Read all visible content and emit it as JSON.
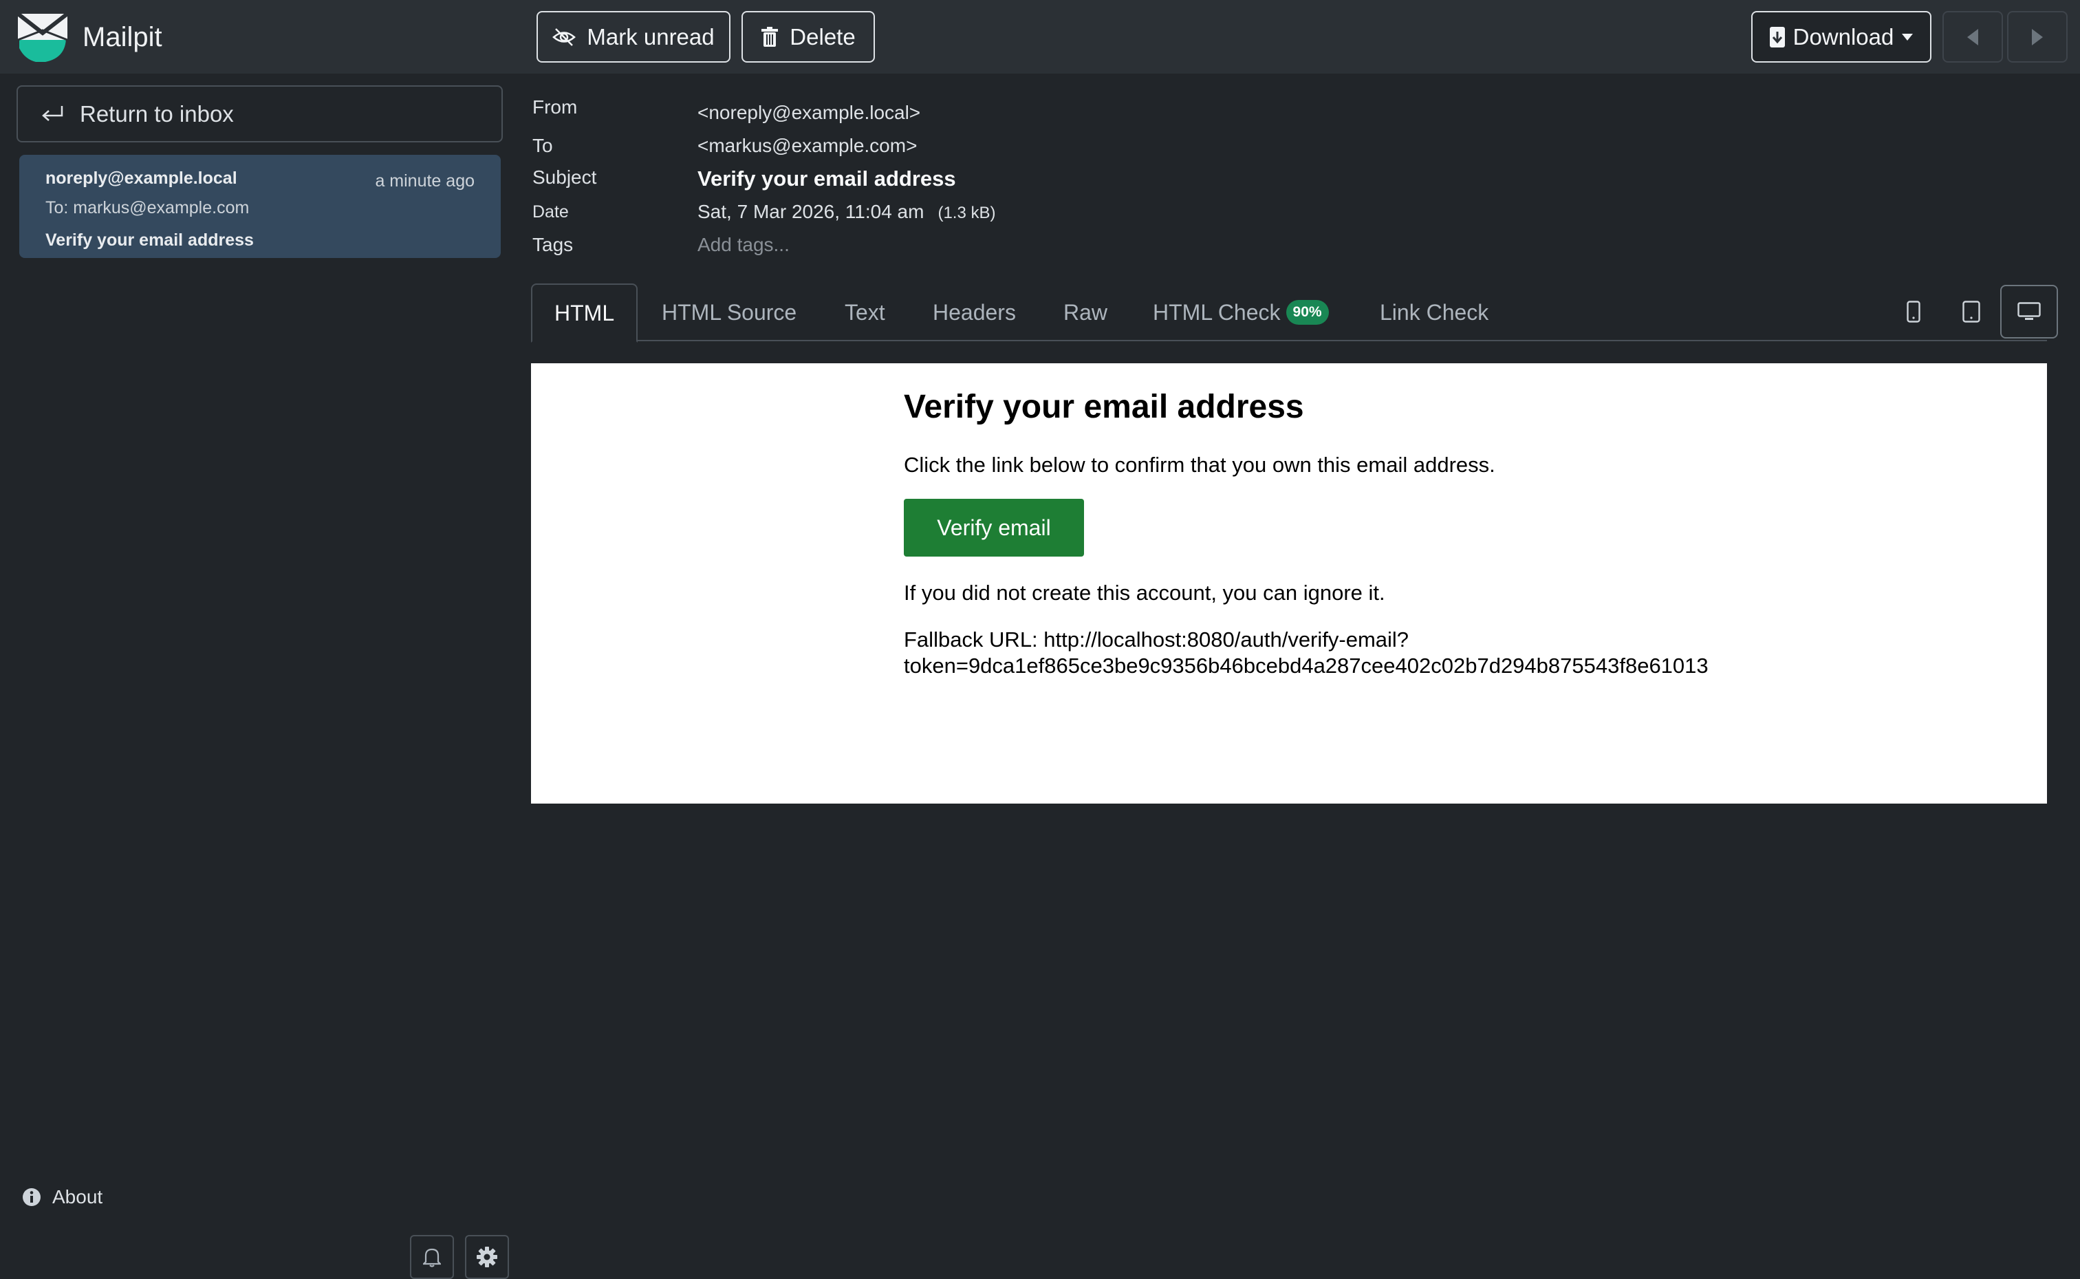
{
  "app": {
    "name": "Mailpit"
  },
  "toolbar": {
    "mark_unread": "Mark unread",
    "delete": "Delete",
    "download": "Download"
  },
  "sidebar": {
    "return_label": "Return to inbox",
    "message": {
      "from": "noreply@example.local",
      "time": "a minute ago",
      "to": "To: markus@example.com",
      "subject": "Verify your email address"
    },
    "about": "About"
  },
  "headers": {
    "from_label": "From",
    "from_value": "<noreply@example.local>",
    "to_label": "To",
    "to_value": "<markus@example.com>",
    "subject_label": "Subject",
    "subject_value": "Verify your email address",
    "date_label": "Date",
    "date_value": "Sat, 7 Mar 2026, 11:04 am",
    "size": "(1.3 kB)",
    "tags_label": "Tags",
    "tags_placeholder": "Add tags..."
  },
  "tabs": {
    "html": "HTML",
    "html_source": "HTML Source",
    "text": "Text",
    "headers": "Headers",
    "raw": "Raw",
    "html_check": "HTML Check",
    "html_check_badge": "90%",
    "link_check": "Link Check"
  },
  "email": {
    "heading": "Verify your email address",
    "intro": "Click the link below to confirm that you own this email address.",
    "button": "Verify email",
    "ignore": "If you did not create this account, you can ignore it.",
    "fallback_line1": "Fallback URL: http://localhost:8080/auth/verify-email?",
    "fallback_line2": "token=9dca1ef865ce3be9c9356b46bcebd4a287cee402c02b7d294b875543f8e61013"
  },
  "colors": {
    "topbar": "#2b3035",
    "background": "#212529",
    "selected_message": "#34495e",
    "accent_green": "#198754",
    "verify_button": "#1e7e34"
  },
  "icons": {
    "logo": "mailpit-logo",
    "mark_unread": "eye-slash-icon",
    "delete": "trash-icon",
    "download": "file-download-icon",
    "prev": "caret-left-icon",
    "next": "caret-right-icon",
    "return": "return-arrow-icon",
    "about": "info-circle-icon",
    "notifications": "bell-icon",
    "settings": "gear-icon",
    "phone_view": "phone-icon",
    "tablet_view": "tablet-icon",
    "desktop_view": "monitor-icon"
  }
}
